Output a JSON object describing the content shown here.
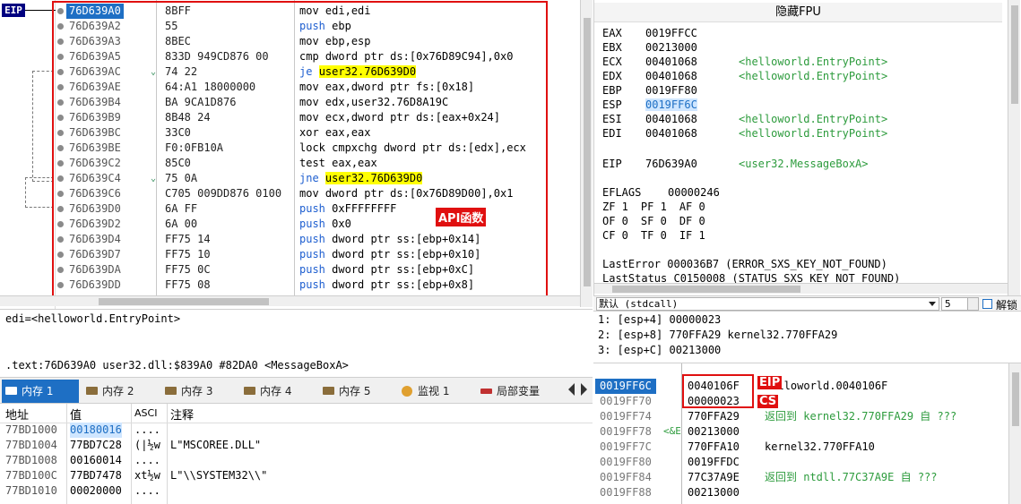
{
  "eip_tag": "EIP",
  "disasm": {
    "rows": [
      {
        "addr": "76D639A0",
        "bytes": "8BFF",
        "mnemonic": "mov",
        "ops": "edi,edi",
        "current": true
      },
      {
        "addr": "76D639A2",
        "bytes": "55",
        "mnemonic": "push",
        "ops": "ebp"
      },
      {
        "addr": "76D639A3",
        "bytes": "8BEC",
        "mnemonic": "mov",
        "ops": "ebp,esp"
      },
      {
        "addr": "76D639A5",
        "bytes": "833D 949CD876 00",
        "mnemonic": "cmp",
        "ops": "dword ptr ds:[0x76D89C94],0x0"
      },
      {
        "addr": "76D639AC",
        "bytes": "74 22",
        "mnemonic": "je",
        "ops": "user32.76D639D0",
        "jump": true
      },
      {
        "addr": "76D639AE",
        "bytes": "64:A1 18000000",
        "mnemonic": "mov",
        "ops": "eax,dword ptr fs:[0x18]"
      },
      {
        "addr": "76D639B4",
        "bytes": "BA 9CA1D876",
        "mnemonic": "mov",
        "ops": "edx,user32.76D8A19C"
      },
      {
        "addr": "76D639B9",
        "bytes": "8B48 24",
        "mnemonic": "mov",
        "ops": "ecx,dword ptr ds:[eax+0x24]"
      },
      {
        "addr": "76D639BC",
        "bytes": "33C0",
        "mnemonic": "xor",
        "ops": "eax,eax"
      },
      {
        "addr": "76D639BE",
        "bytes": "F0:0FB10A",
        "mnemonic": "lock cmpxchg",
        "ops": "dword ptr ds:[edx],ecx"
      },
      {
        "addr": "76D639C2",
        "bytes": "85C0",
        "mnemonic": "test",
        "ops": "eax,eax"
      },
      {
        "addr": "76D639C4",
        "bytes": "75 0A",
        "mnemonic": "jne",
        "ops": "user32.76D639D0",
        "jump": true
      },
      {
        "addr": "76D639C6",
        "bytes": "C705 009DD876 0100",
        "mnemonic": "mov",
        "ops": "dword ptr ds:[0x76D89D00],0x1"
      },
      {
        "addr": "76D639D0",
        "bytes": "6A FF",
        "mnemonic": "push",
        "ops": "0xFFFFFFFF"
      },
      {
        "addr": "76D639D2",
        "bytes": "6A 00",
        "mnemonic": "push",
        "ops": "0x0"
      },
      {
        "addr": "76D639D4",
        "bytes": "FF75 14",
        "mnemonic": "push",
        "ops": "dword ptr ss:[ebp+0x14]"
      },
      {
        "addr": "76D639D7",
        "bytes": "FF75 10",
        "mnemonic": "push",
        "ops": "dword ptr ss:[ebp+0x10]"
      },
      {
        "addr": "76D639DA",
        "bytes": "FF75 0C",
        "mnemonic": "push",
        "ops": "dword ptr ss:[ebp+0xC]"
      },
      {
        "addr": "76D639DD",
        "bytes": "FF75 08",
        "mnemonic": "push",
        "ops": "dword ptr ss:[ebp+0x8]"
      }
    ],
    "annotation": "API函数"
  },
  "registers": {
    "title": "隐藏FPU",
    "general": [
      {
        "name": "EAX",
        "value": "0019FFCC",
        "comment": ""
      },
      {
        "name": "EBX",
        "value": "00213000",
        "comment": ""
      },
      {
        "name": "ECX",
        "value": "00401068",
        "comment": "<helloworld.EntryPoint>"
      },
      {
        "name": "EDX",
        "value": "00401068",
        "comment": "<helloworld.EntryPoint>"
      },
      {
        "name": "EBP",
        "value": "0019FF80",
        "comment": ""
      },
      {
        "name": "ESP",
        "value": "0019FF6C",
        "comment": ""
      },
      {
        "name": "ESI",
        "value": "00401068",
        "comment": "<helloworld.EntryPoint>"
      },
      {
        "name": "EDI",
        "value": "00401068",
        "comment": "<helloworld.EntryPoint>"
      }
    ],
    "eip": {
      "name": "EIP",
      "value": "76D639A0",
      "comment": "<user32.MessageBoxA>"
    },
    "eflags": {
      "name": "EFLAGS",
      "value": "00000246"
    },
    "flags": [
      [
        "ZF 1",
        "PF 1",
        "AF 0"
      ],
      [
        "OF 0",
        "SF 0",
        "DF 0"
      ],
      [
        "CF 0",
        "TF 0",
        "IF 1"
      ]
    ],
    "last_error": "LastError   000036B7 (ERROR_SXS_KEY_NOT_FOUND)",
    "last_status": "LastStatus C0150008 (STATUS_SXS_KEY_NOT_FOUND)"
  },
  "info": {
    "line1": "edi=<helloworld.EntryPoint>",
    "line2": ".text:76D639A0 user32.dll:$839A0 #82DA0 <MessageBoxA>"
  },
  "tabs": [
    "内存 1",
    "内存 2",
    "内存 3",
    "内存 4",
    "内存 5",
    "监视 1",
    "局部变量"
  ],
  "dump": {
    "headers": [
      "地址",
      "值",
      "ASCI",
      "注释"
    ],
    "rows": [
      {
        "addr": "77BD1000",
        "value": "00180016",
        "ascii": "....",
        "comment": ""
      },
      {
        "addr": "77BD1004",
        "value": "77BD7C28",
        "ascii": "(|½w",
        "comment": "L\"MSCOREE.DLL\""
      },
      {
        "addr": "77BD1008",
        "value": "00160014",
        "ascii": "....",
        "comment": ""
      },
      {
        "addr": "77BD100C",
        "value": "77BD7478",
        "ascii": "xt½w",
        "comment": "L\"\\\\SYSTEM32\\\\\""
      },
      {
        "addr": "77BD1010",
        "value": "00020000",
        "ascii": "....",
        "comment": ""
      }
    ]
  },
  "args": {
    "convention": "默认 (stdcall)",
    "count": "5",
    "unlock_label": "解锁",
    "rows": [
      "1: [esp+4] 00000023",
      "2: [esp+8] 770FFA29 kernel32.770FFA29",
      "3: [esp+C] 00213000"
    ]
  },
  "stack": {
    "rows": [
      {
        "addr": "0019FF6C",
        "value": "0040106F",
        "comment": "helloworld.0040106F",
        "current": true
      },
      {
        "addr": "0019FF70",
        "value": "00000023",
        "comment": ""
      },
      {
        "addr": "0019FF74",
        "value": "770FFA29",
        "comment": "返回到 kernel32.770FFA29 自 ???"
      },
      {
        "addr": "0019FF78",
        "value": "00213000",
        "comment": ""
      },
      {
        "addr": "0019FF7C",
        "value": "770FFA10",
        "comment": "kernel32.770FFA10",
        "dark": true
      },
      {
        "addr": "0019FF80",
        "value": "0019FFDC",
        "comment": ""
      },
      {
        "addr": "0019FF84",
        "value": "77C37A9E",
        "comment": "返回到 ntdll.77C37A9E 自 ???"
      },
      {
        "addr": "0019FF88",
        "value": "00213000",
        "comment": ""
      }
    ],
    "ebp_marker": "<&E",
    "annotations": {
      "eip": "EIP",
      "cs": "CS"
    }
  },
  "colors": {
    "accent": "#1E6FC4",
    "annotation_red": "#E01010",
    "comment_green": "#2C9B3C"
  }
}
